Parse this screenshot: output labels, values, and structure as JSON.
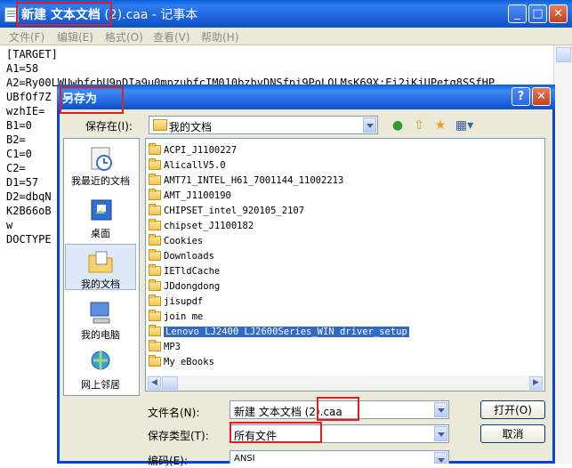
{
  "notepad": {
    "title_main": "新建 文本文档",
    "title_rest": " (2).caa - 记事本",
    "menu": [
      "文件(F)",
      "编辑(E)",
      "格式(O)",
      "查看(V)",
      "帮助(H)"
    ],
    "lines": [
      "[TARGET]",
      "A1=58",
      "A2=Ry00LWUwbfcbU9nDIa9u0mpzubfcIM010bzbvDNSfpi9PoLOLMsK69X:Ei2iKjUPetq8SSfHP",
      "UBfOf7Z",
      "wzhIE=",
      "B1=0",
      "B2=",
      "C1=0",
      "C2=",
      "D1=57",
      "D2=dbqN",
      "K2B66oB",
      "w",
      "DOCTYPE"
    ]
  },
  "dialog": {
    "title": "另存为",
    "help": "?",
    "close": "✕",
    "save_in_label": "保存在(I):",
    "save_in_value": "我的文档",
    "places": [
      "我最近的文档",
      "桌面",
      "我的文档",
      "我的电脑",
      "网上邻居"
    ],
    "files": [
      "ACPI_J1100227",
      "AlicallV5.0",
      "AMT71_INTEL_H61_7001144_11002213",
      "AMT_J1100190",
      "CHIPSET_intel_920105_2107",
      "chipset_J1100182",
      "Cookies",
      "Downloads",
      "IETldCache",
      "JDdongdong",
      "jisupdf",
      "join me",
      "Lenovo LJ2400 LJ2600Series_WIN driver_setup",
      "MP3",
      "My eBooks"
    ],
    "filename_label": "文件名(N):",
    "filename_value_a": "新建 文本文档 (",
    "filename_value_b": "2).caa",
    "filetype_label": "保存类型(T):",
    "filetype_value": "所有文件",
    "encoding_label": "编码(E):",
    "encoding_value": "ANSI",
    "open_button": "打开(O)",
    "cancel_button": "取消"
  },
  "colors": {
    "title_blue": "#0a5fd8",
    "highlight": "#e02020",
    "selection": "#316ac5"
  }
}
